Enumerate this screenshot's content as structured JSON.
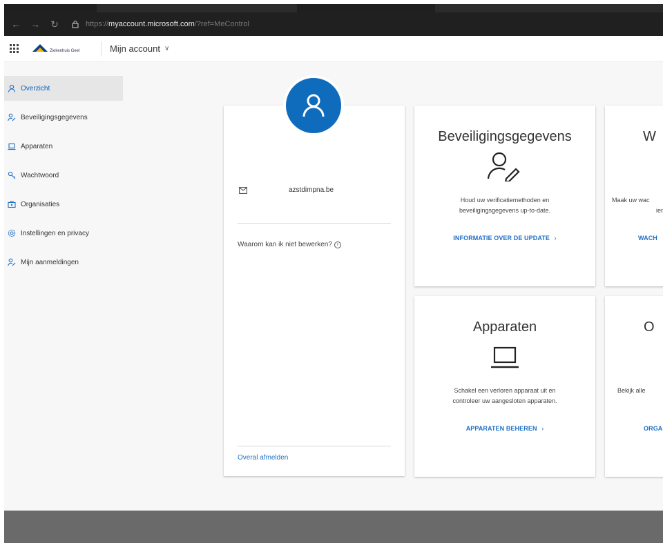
{
  "browser": {
    "url_prefix": "https://",
    "url_host": "myaccount.microsoft.com",
    "url_path": "/?ref=MeControl"
  },
  "header": {
    "logo_text": "Ziekenhuis Geel",
    "app_title": "Mijn account"
  },
  "sidebar": {
    "items": [
      {
        "label": "Overzicht",
        "icon": "person-icon",
        "active": true
      },
      {
        "label": "Beveiligingsgegevens",
        "icon": "person-key-icon",
        "active": false
      },
      {
        "label": "Apparaten",
        "icon": "laptop-icon",
        "active": false
      },
      {
        "label": "Wachtwoord",
        "icon": "key-icon",
        "active": false
      },
      {
        "label": "Organisaties",
        "icon": "briefcase-icon",
        "active": false
      },
      {
        "label": "Instellingen en privacy",
        "icon": "gear-icon",
        "active": false
      },
      {
        "label": "Mijn aanmeldingen",
        "icon": "person-key-icon",
        "active": false
      }
    ]
  },
  "profile": {
    "email": "azstdimpna.be",
    "why_text": "Waarom kan ik niet bewerken?",
    "signout": "Overal afmelden"
  },
  "tiles": {
    "security": {
      "title": "Beveiligingsgegevens",
      "desc1": "Houd uw verificatiemethoden en",
      "desc2": "beveiligingsgegevens up-to-date.",
      "link": "INFORMATIE OVER DE UPDATE"
    },
    "password": {
      "title": "W",
      "desc1": "Maak uw wac",
      "desc2": "ien",
      "link": "WACH"
    },
    "devices": {
      "title": "Apparaten",
      "desc1": "Schakel een verloren apparaat uit en",
      "desc2": "controleer uw aangesloten apparaten.",
      "link": "APPARATEN BEHEREN"
    },
    "organizations": {
      "title": "O",
      "desc1": "Bekijk alle",
      "link": "ORGA"
    }
  },
  "colors": {
    "accent": "#0f6cbd",
    "link": "#1f6fc5"
  }
}
